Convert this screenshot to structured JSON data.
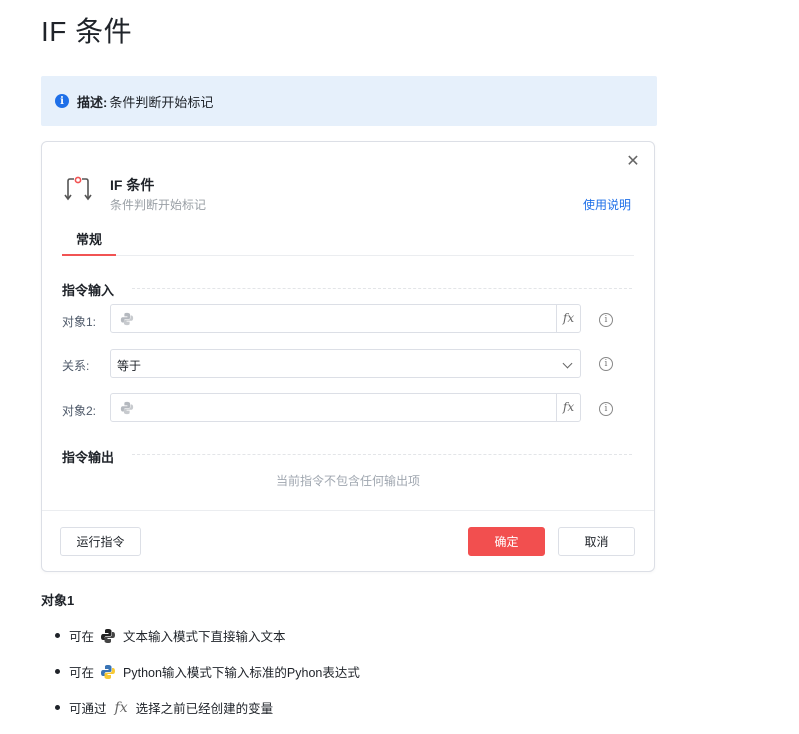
{
  "page": {
    "title": "IF 条件"
  },
  "description": {
    "label": "描述:",
    "text": "条件判断开始标记"
  },
  "dialog": {
    "title": "IF 条件",
    "subtitle": "条件判断开始标记",
    "help_link": "使用说明",
    "tabs": [
      {
        "label": "常规",
        "active": true
      }
    ],
    "input_section": {
      "title": "指令输入",
      "rows": [
        {
          "label": "对象1:",
          "type": "text",
          "value": "",
          "icon": "python-icon",
          "fx": "fx"
        },
        {
          "label": "关系:",
          "type": "select",
          "value": "等于"
        },
        {
          "label": "对象2:",
          "type": "text",
          "value": "",
          "icon": "python-icon",
          "fx": "fx"
        }
      ]
    },
    "output_section": {
      "title": "指令输出",
      "empty_text": "当前指令不包含任何输出项"
    },
    "buttons": {
      "run": "运行指令",
      "ok": "确定",
      "cancel": "取消"
    }
  },
  "doc": {
    "heading": "对象1",
    "items": [
      {
        "prefix": "可在",
        "icon": "python-bw-icon",
        "text": "文本输入模式下直接输入文本"
      },
      {
        "prefix": "可在",
        "icon": "python-color-icon",
        "text": "Python输入模式下输入标准的Pyhon表达式"
      },
      {
        "prefix": "可通过",
        "icon": "fx-icon",
        "icon_text": "fx",
        "text": "选择之前已经创建的变量"
      }
    ]
  },
  "colors": {
    "accent_blue": "#1e6fe8",
    "danger_red": "#f24f4f",
    "info_bg": "#e6f0fb"
  }
}
